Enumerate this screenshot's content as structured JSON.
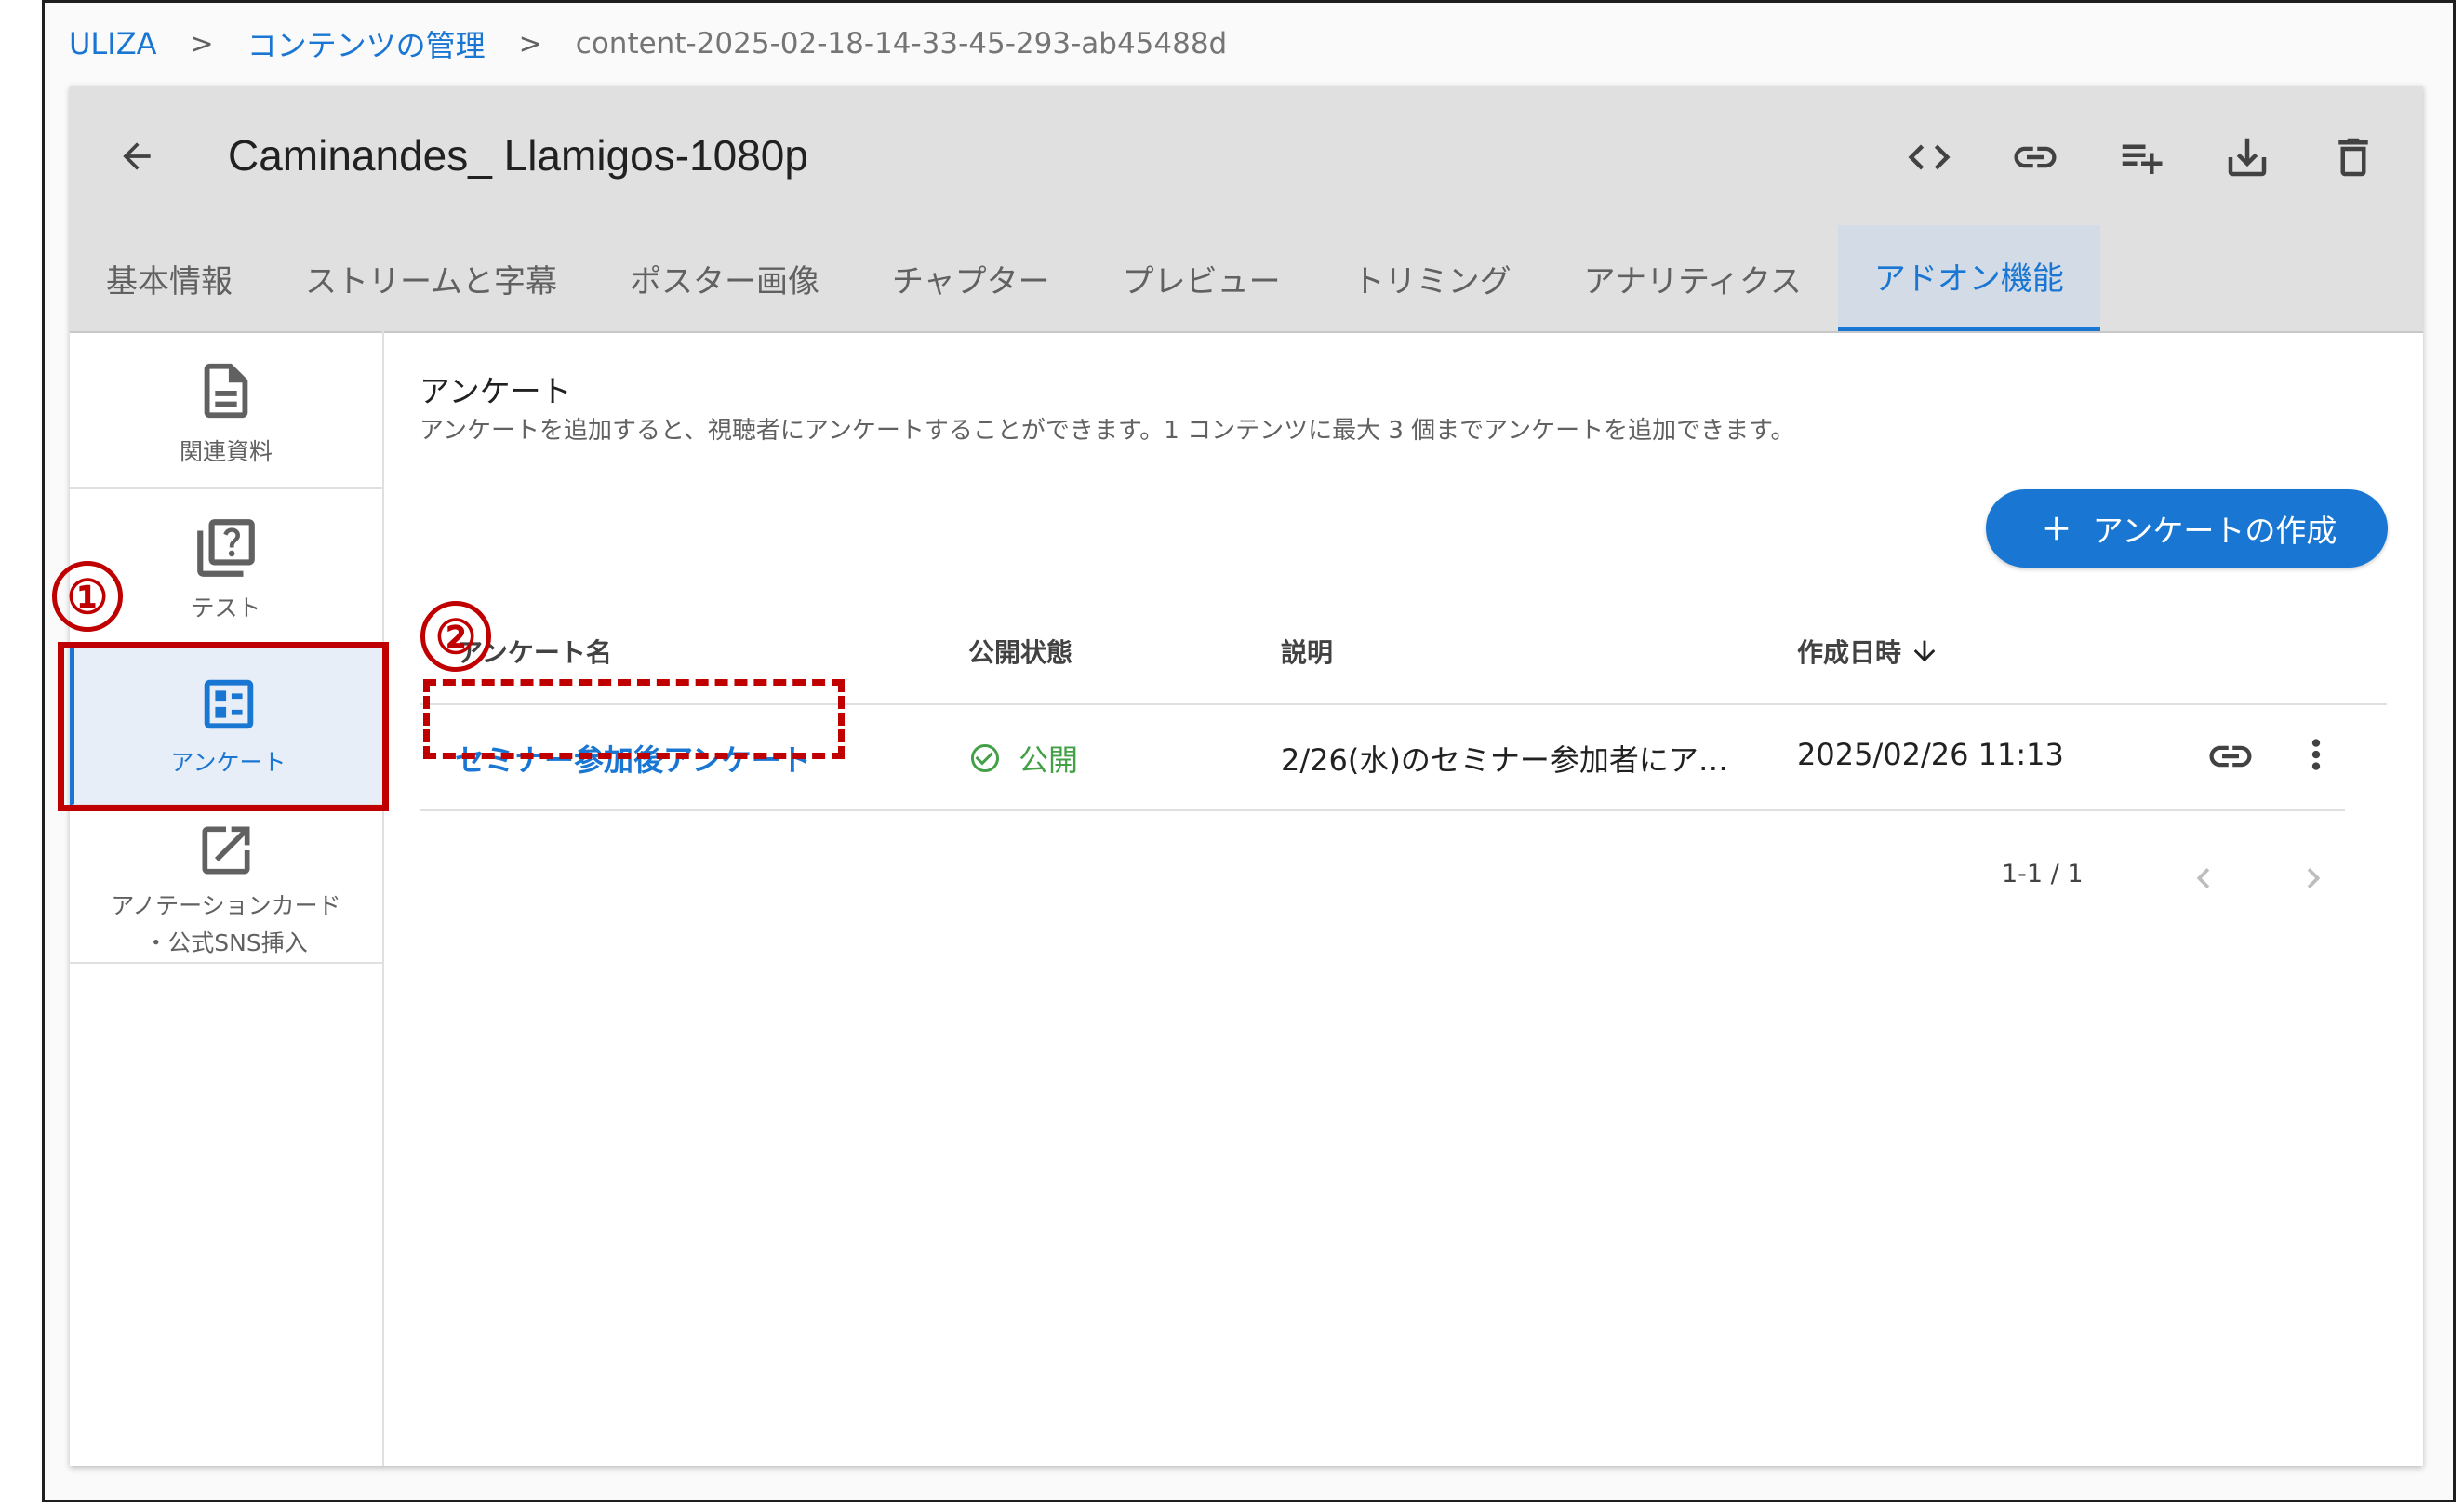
{
  "breadcrumb": {
    "root": "ULIZA",
    "sep": ">",
    "section": "コンテンツの管理",
    "current": "content-2025-02-18-14-33-45-293-ab45488d"
  },
  "header": {
    "title": "Caminandes_ Llamigos-1080p",
    "icons": [
      "back-arrow-icon",
      "code-icon",
      "link-icon",
      "playlist-add-icon",
      "download-icon",
      "delete-icon"
    ]
  },
  "tabs": [
    {
      "label": "基本情報"
    },
    {
      "label": "ストリームと字幕"
    },
    {
      "label": "ポスター画像"
    },
    {
      "label": "チャプター"
    },
    {
      "label": "プレビュー"
    },
    {
      "label": "トリミング"
    },
    {
      "label": "アナリティクス"
    },
    {
      "label": "アドオン機能",
      "active": true
    }
  ],
  "sidenav": [
    {
      "label": "関連資料",
      "icon": "document-icon"
    },
    {
      "label": "テスト",
      "icon": "quiz-icon"
    },
    {
      "label": "アンケート",
      "icon": "survey-icon",
      "active": true
    },
    {
      "label": "アノテーションカード\n・公式SNS挿入",
      "label_line1": "アノテーションカード",
      "label_line2": "・公式SNS挿入",
      "icon": "external-link-icon"
    }
  ],
  "section": {
    "title": "アンケート",
    "description": "アンケートを追加すると、視聴者にアンケートすることができます。1 コンテンツに最大 3 個までアンケートを追加できます。",
    "create_button": "アンケートの作成"
  },
  "table": {
    "columns": [
      "アンケート名",
      "公開状態",
      "説明",
      "作成日時"
    ],
    "rows": [
      {
        "name": "セミナー参加後アンケート",
        "status": "公開",
        "description": "2/26(水)のセミナー参加者にア…",
        "created": "2025/02/26 11:13"
      }
    ],
    "pagination": "1-1 / 1"
  },
  "annotations": {
    "one": "①",
    "two": "②",
    "color": "#c00000"
  },
  "colors": {
    "accent": "#1976d2",
    "success": "#43a047",
    "header_bg": "#e0e0e0"
  }
}
